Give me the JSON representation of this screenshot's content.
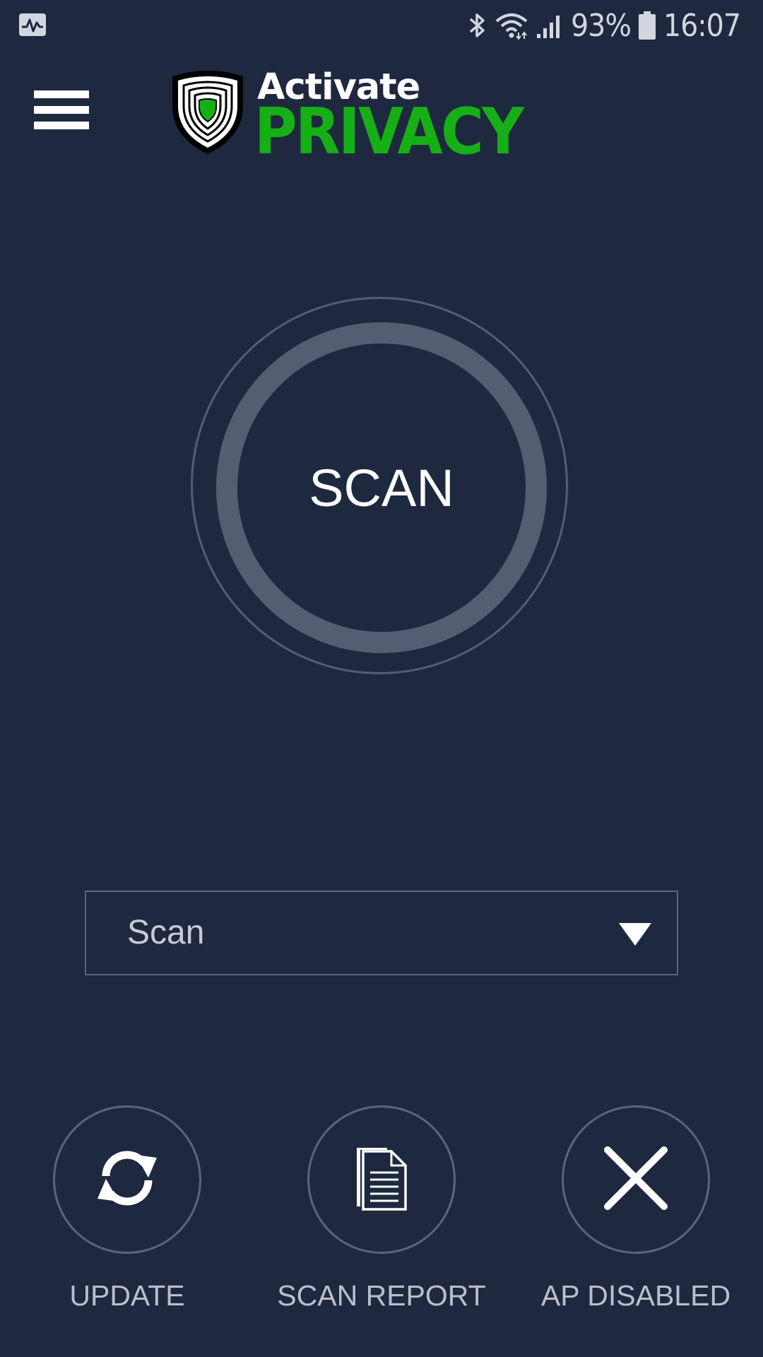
{
  "status_bar": {
    "battery_percent": "93%",
    "time": "16:07",
    "icons": [
      "activity-monitor-icon",
      "bluetooth-icon",
      "wifi-icon",
      "signal-icon",
      "battery-icon"
    ]
  },
  "header": {
    "menu_icon": "hamburger-menu-icon",
    "logo": {
      "line1": "Activate",
      "line2": "PRIVACY",
      "line2_color": "#16b016"
    }
  },
  "scan_button": {
    "label": "SCAN"
  },
  "scan_mode_select": {
    "selected": "Scan",
    "icon": "caret-down-icon"
  },
  "actions": [
    {
      "label": "UPDATE",
      "icon": "refresh-icon"
    },
    {
      "label": "SCAN REPORT",
      "icon": "document-icon"
    },
    {
      "label": "AP DISABLED",
      "icon": "close-icon"
    }
  ],
  "colors": {
    "background": "#1e2940",
    "ring": "#545e73",
    "accent_green": "#16b016",
    "muted_text": "#b9bfcb"
  }
}
